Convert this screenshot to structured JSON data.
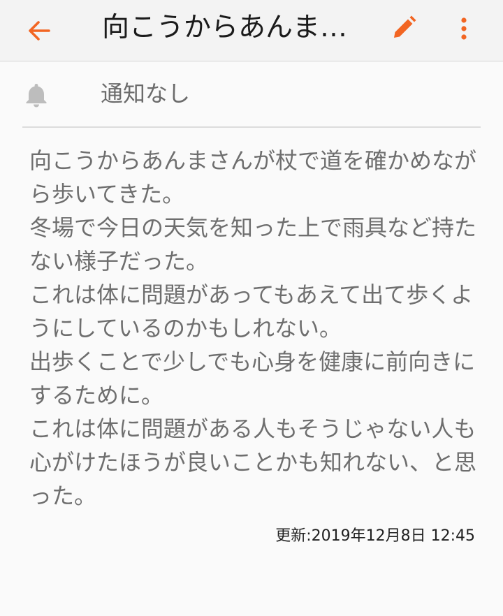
{
  "colors": {
    "accent": "#f26522",
    "toolbar_bg": "#f3f3f3",
    "text_gray": "#6e6e6e"
  },
  "header": {
    "back_icon": "arrow-left-icon",
    "title": "向こうからあんまさんが杖で道を確かめながら歩いてきた。",
    "edit_icon": "pencil-icon",
    "more_icon": "more-vertical-icon"
  },
  "notification": {
    "icon": "bell-icon",
    "label": "通知なし"
  },
  "note": {
    "lines": [
      "向こうからあんまさんが杖で道を確かめなが",
      "ら歩いてきた。",
      "冬場で今日の天気を知った上で雨具など持た",
      "ない様子だった。",
      "これは体に問題があってもあえて出て歩くよ",
      "うにしているのかもしれない。",
      "出歩くことで少しでも心身を健康に前向きに",
      "するために。",
      "これは体に問題がある人もそうじゃない人も",
      "心がけたほうが良いことかも知れない、と思",
      "った。"
    ],
    "updated": "更新:2019年12月8日 12:45"
  }
}
